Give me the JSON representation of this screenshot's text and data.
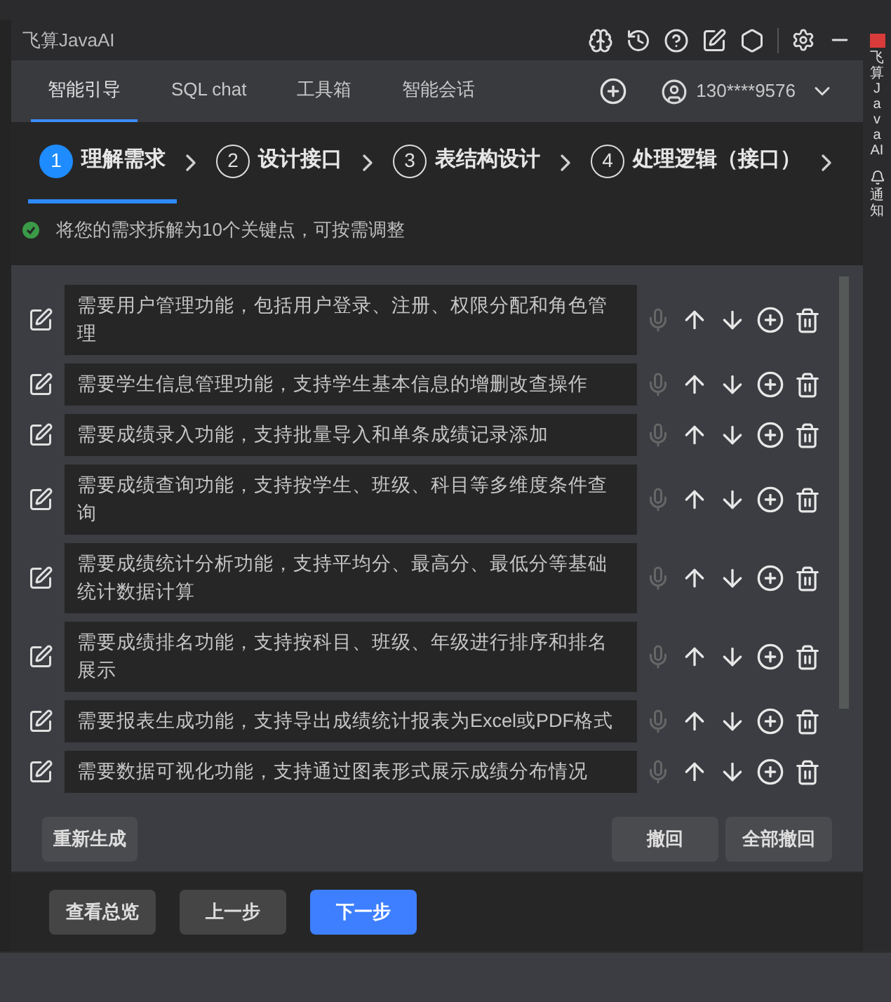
{
  "window": {
    "title": "飞算JavaAI"
  },
  "tabs": [
    {
      "label": "智能引导",
      "selected": true
    },
    {
      "label": "SQL chat",
      "selected": false
    },
    {
      "label": "工具箱",
      "selected": false
    },
    {
      "label": "智能会话",
      "selected": false
    }
  ],
  "account": {
    "name": "130****9576"
  },
  "steps": [
    {
      "number": "1",
      "label": "理解需求",
      "selected": true
    },
    {
      "number": "2",
      "label": "设计接口",
      "selected": false
    },
    {
      "number": "3",
      "label": "表结构设计",
      "selected": false
    },
    {
      "number": "4",
      "label": "处理逻辑（接口）",
      "selected": false
    }
  ],
  "info": "将您的需求拆解为10个关键点，可按需调整",
  "requirements": [
    {
      "text": "需要用户管理功能，包括用户登录、注册、权限分配和角色管理"
    },
    {
      "text": "需要学生信息管理功能，支持学生基本信息的增删改查操作"
    },
    {
      "text": "需要成绩录入功能，支持批量导入和单条成绩记录添加"
    },
    {
      "text": "需要成绩查询功能，支持按学生、班级、科目等多维度条件查询"
    },
    {
      "text": "需要成绩统计分析功能，支持平均分、最高分、最低分等基础统计数据计算"
    },
    {
      "text": "需要成绩排名功能，支持按科目、班级、年级进行排序和排名展示"
    },
    {
      "text": "需要报表生成功能，支持导出成绩统计报表为Excel或PDF格式"
    },
    {
      "text": "需要数据可视化功能，支持通过图表形式展示成绩分布情况"
    }
  ],
  "list_actions": {
    "regenerate": "重新生成",
    "undo": "撤回",
    "undo_all": "全部撤回"
  },
  "footer": [
    {
      "label": "查看总览",
      "kind": "secondary"
    },
    {
      "label": "上一步",
      "kind": "secondary"
    },
    {
      "label": "下一步",
      "kind": "primary"
    }
  ],
  "right_sidebar": [
    {
      "label": "飞算JavaAI",
      "kind": "app"
    },
    {
      "label": "通知",
      "kind": "notify"
    }
  ]
}
